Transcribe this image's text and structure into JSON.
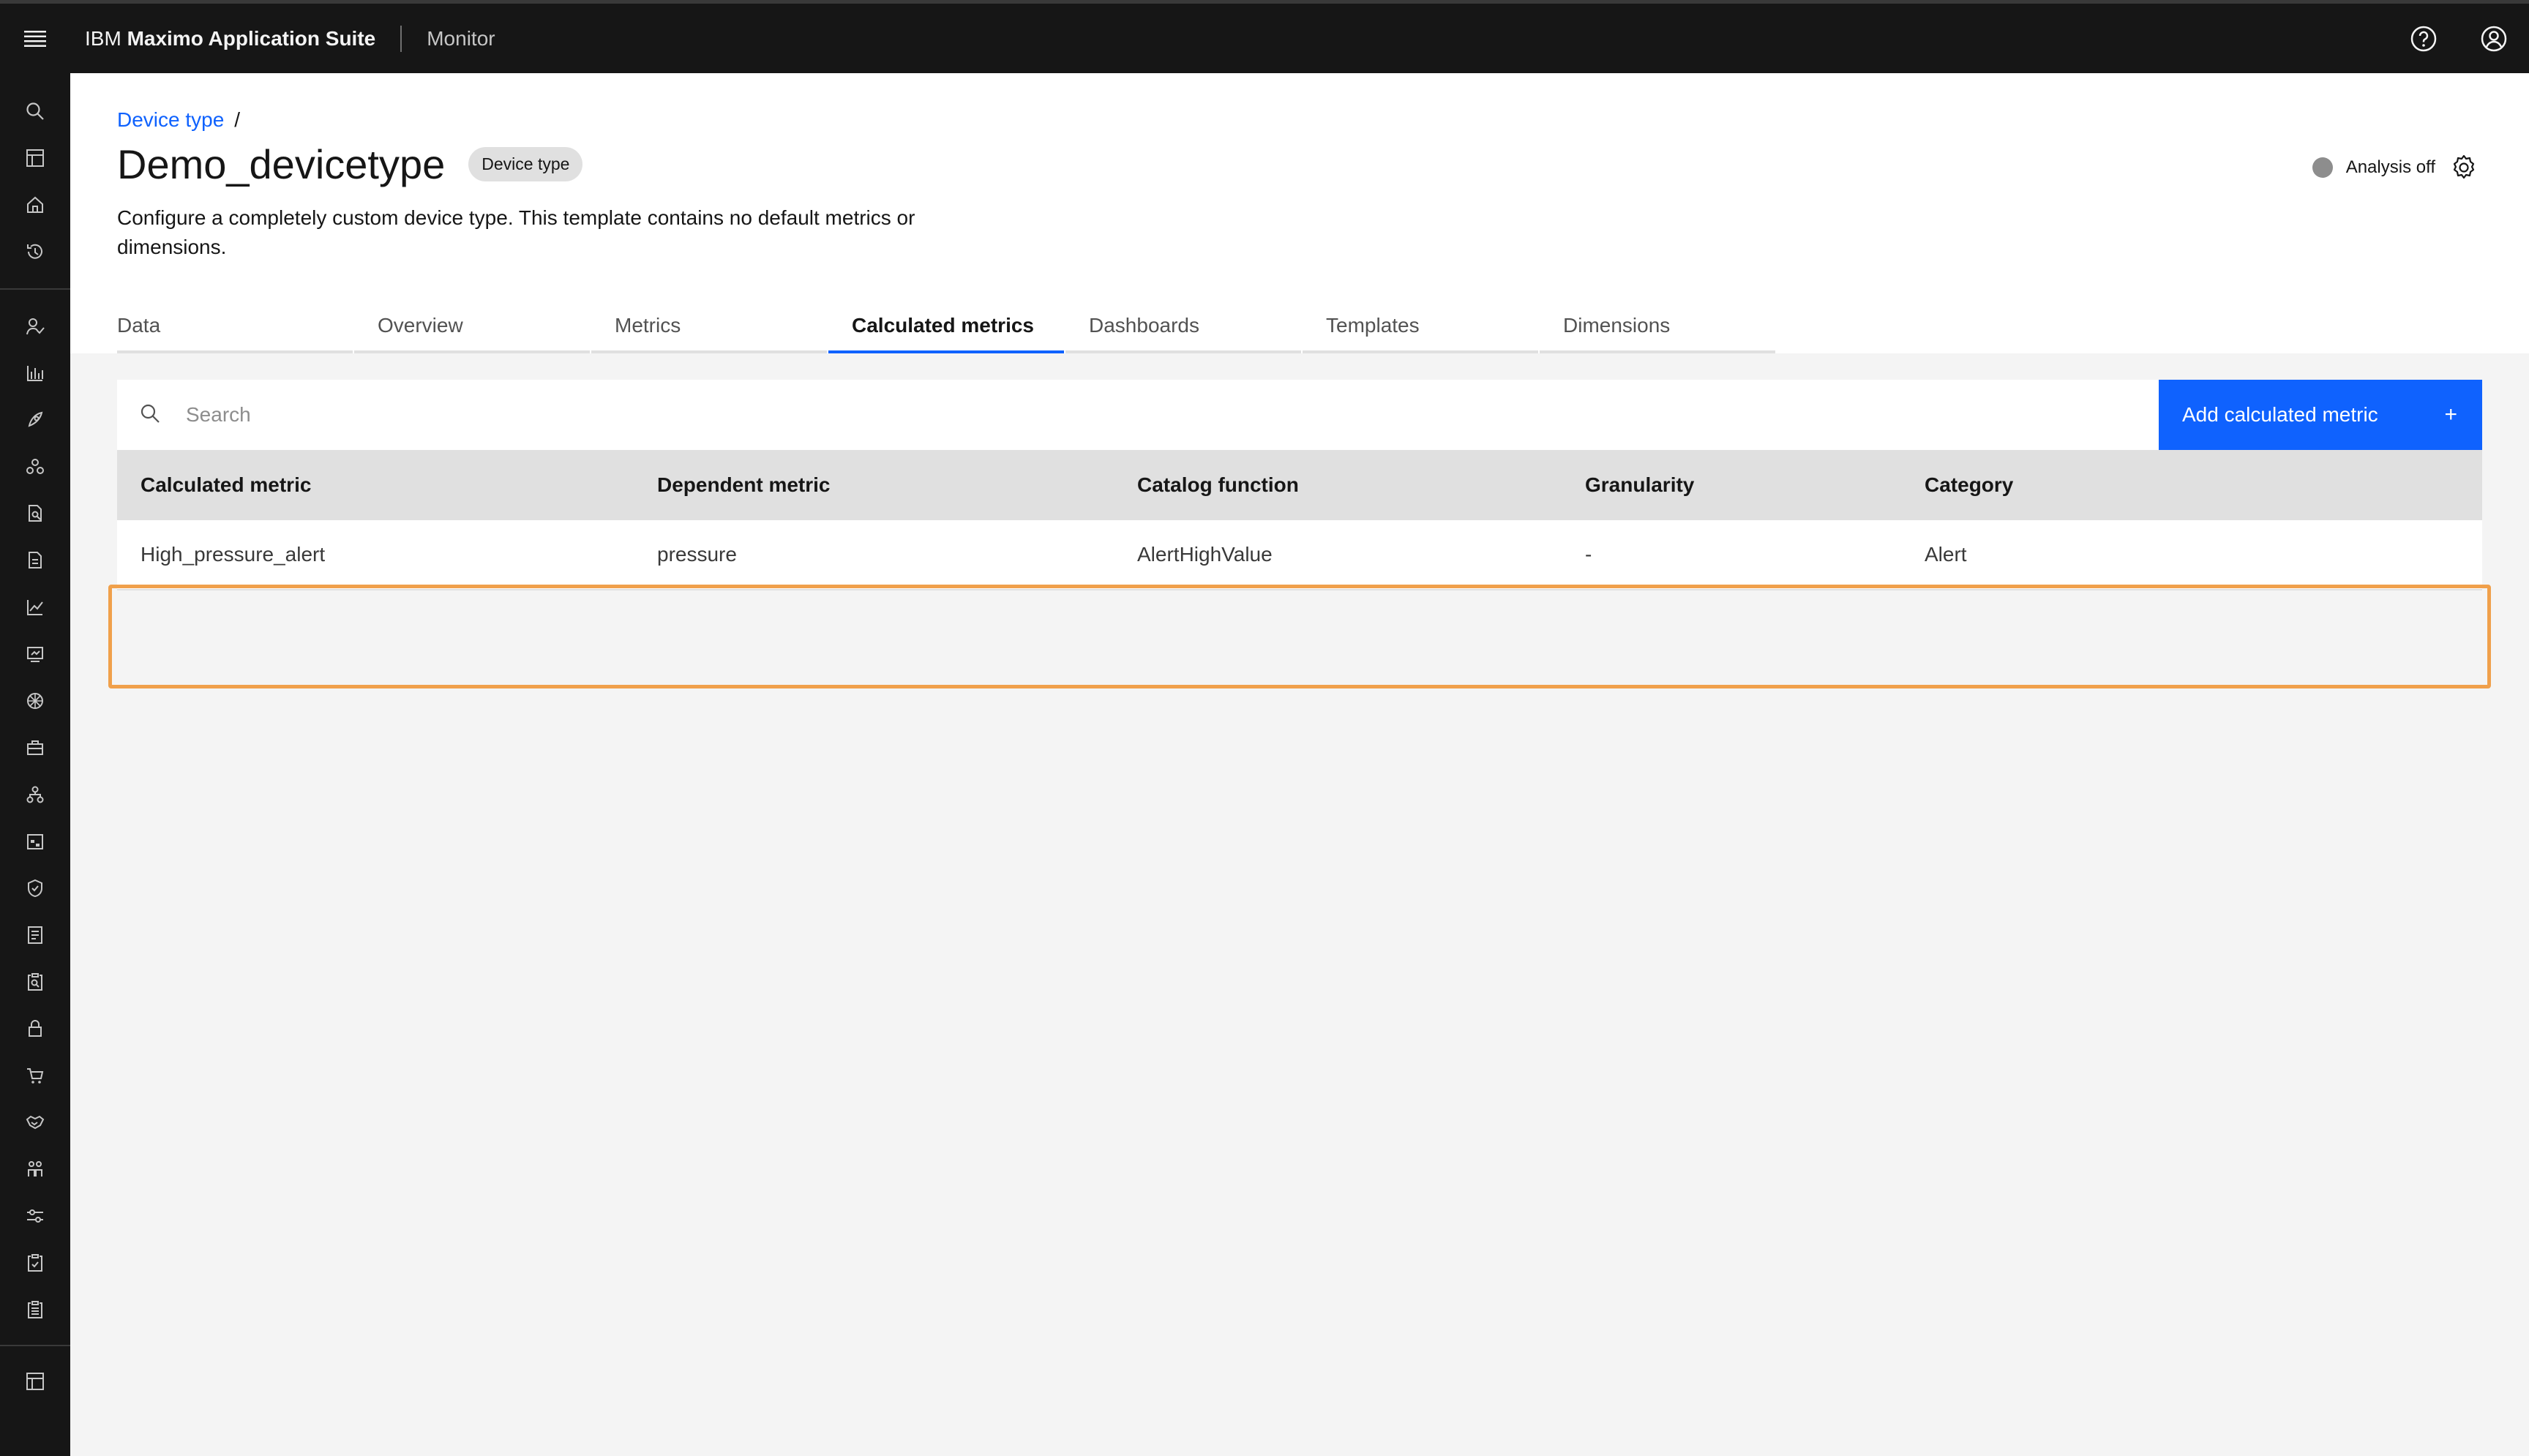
{
  "header": {
    "brand_prefix": "IBM",
    "brand_name": "Maximo Application Suite",
    "app_name": "Monitor"
  },
  "breadcrumb": {
    "link": "Device type",
    "separator": "/"
  },
  "page": {
    "title": "Demo_devicetype",
    "tag": "Device type",
    "description": "Configure a completely custom device type. This template contains no default metrics or dimensions.",
    "analysis_status": "Analysis off"
  },
  "tabs": [
    {
      "label": "Data"
    },
    {
      "label": "Overview"
    },
    {
      "label": "Metrics"
    },
    {
      "label": "Calculated metrics",
      "active": true
    },
    {
      "label": "Dashboards"
    },
    {
      "label": "Templates"
    },
    {
      "label": "Dimensions"
    }
  ],
  "toolbar": {
    "search_placeholder": "Search",
    "add_label": "Add calculated metric",
    "add_icon": "+"
  },
  "table": {
    "columns": [
      "Calculated metric",
      "Dependent metric",
      "Catalog function",
      "Granularity",
      "Category"
    ],
    "rows": [
      [
        "High_pressure_alert",
        "pressure",
        "AlertHighValue",
        "-",
        "Alert"
      ]
    ]
  },
  "colors": {
    "accent": "#0f62fe",
    "header_bg": "#161616",
    "highlight": "#f0a04b",
    "status_off": "#8d8d8d"
  },
  "icons": {
    "rail": [
      "search-icon",
      "dashboard-icon",
      "home-icon",
      "history-icon",
      "user-check-icon",
      "bar-chart-icon",
      "rocket-icon",
      "network-icon",
      "document-search-icon",
      "document-icon",
      "line-chart-icon",
      "screen-icon",
      "asset-wheel-icon",
      "toolbox-icon",
      "hierarchy-icon",
      "calendar-grid-icon",
      "shield-icon",
      "report-icon",
      "clipboard-search-icon",
      "lock-icon",
      "cart-icon",
      "handshake-icon",
      "people-icon",
      "sliders-icon",
      "checklist-icon",
      "clipboard-icon",
      "dashboard-bottom-icon"
    ]
  }
}
